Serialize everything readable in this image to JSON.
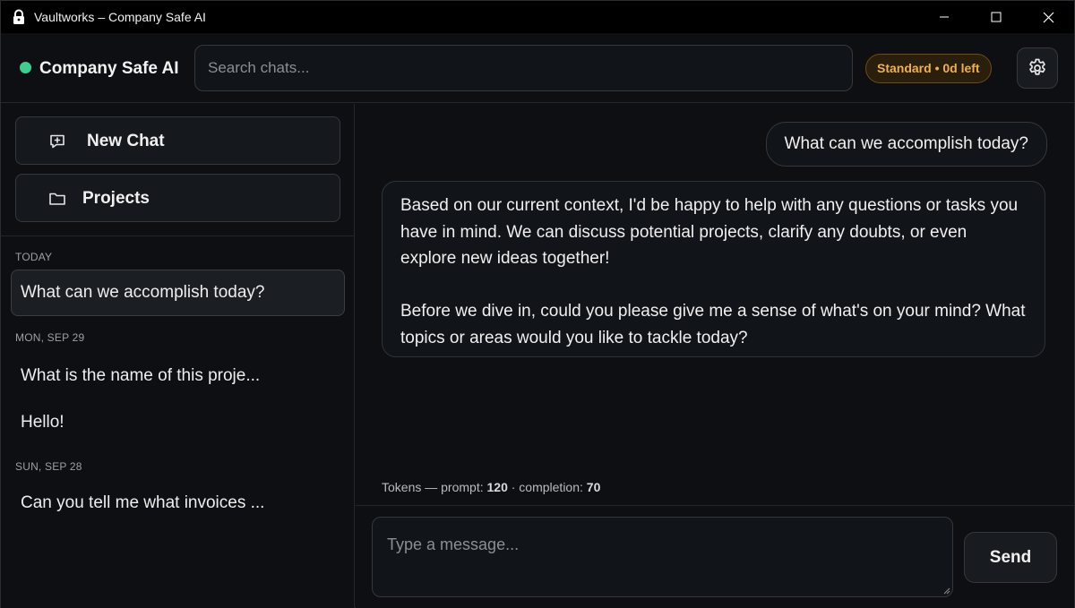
{
  "window": {
    "title": "Vaultworks – Company Safe AI",
    "controls": [
      "minimize-icon",
      "maximize-icon",
      "close-icon"
    ]
  },
  "header": {
    "brand": "Company Safe AI",
    "status_color": "#3ecf8e",
    "search_placeholder": "Search chats...",
    "plan_badge": "Standard • 0d left",
    "settings_icon": "gear-icon"
  },
  "sidebar": {
    "new_chat_label": "New Chat",
    "new_chat_icon": "chat-plus-icon",
    "projects_label": "Projects",
    "projects_icon": "folder-icon",
    "groups": [
      {
        "label": "TODAY",
        "items": [
          {
            "title": "What can we accomplish today?",
            "active": true
          }
        ]
      },
      {
        "label": "MON, SEP 29",
        "items": [
          {
            "title": "What is the name of this proje...",
            "active": false
          },
          {
            "title": "Hello!",
            "active": false
          }
        ]
      },
      {
        "label": "SUN, SEP 28",
        "items": [
          {
            "title": "Can you tell me what invoices ...",
            "active": false
          }
        ]
      }
    ]
  },
  "conversation": {
    "user_message": "What can we accomplish today?",
    "assistant_paragraphs": [
      "Based on our current context, I'd be happy to help with any questions or tasks you have in mind. We can discuss potential projects, clarify any doubts, or even explore new ideas together!",
      "Before we dive in, could you please give me a sense of what's on your mind? What topics or areas would you like to tackle today?"
    ],
    "tokens": {
      "prefix": "Tokens — prompt:",
      "prompt": "120",
      "separator": "· completion:",
      "completion": "70"
    }
  },
  "composer": {
    "placeholder": "Type a message...",
    "send_label": "Send"
  },
  "colors": {
    "accent_warning": "#f0b14a",
    "background": "#0d0f12"
  }
}
